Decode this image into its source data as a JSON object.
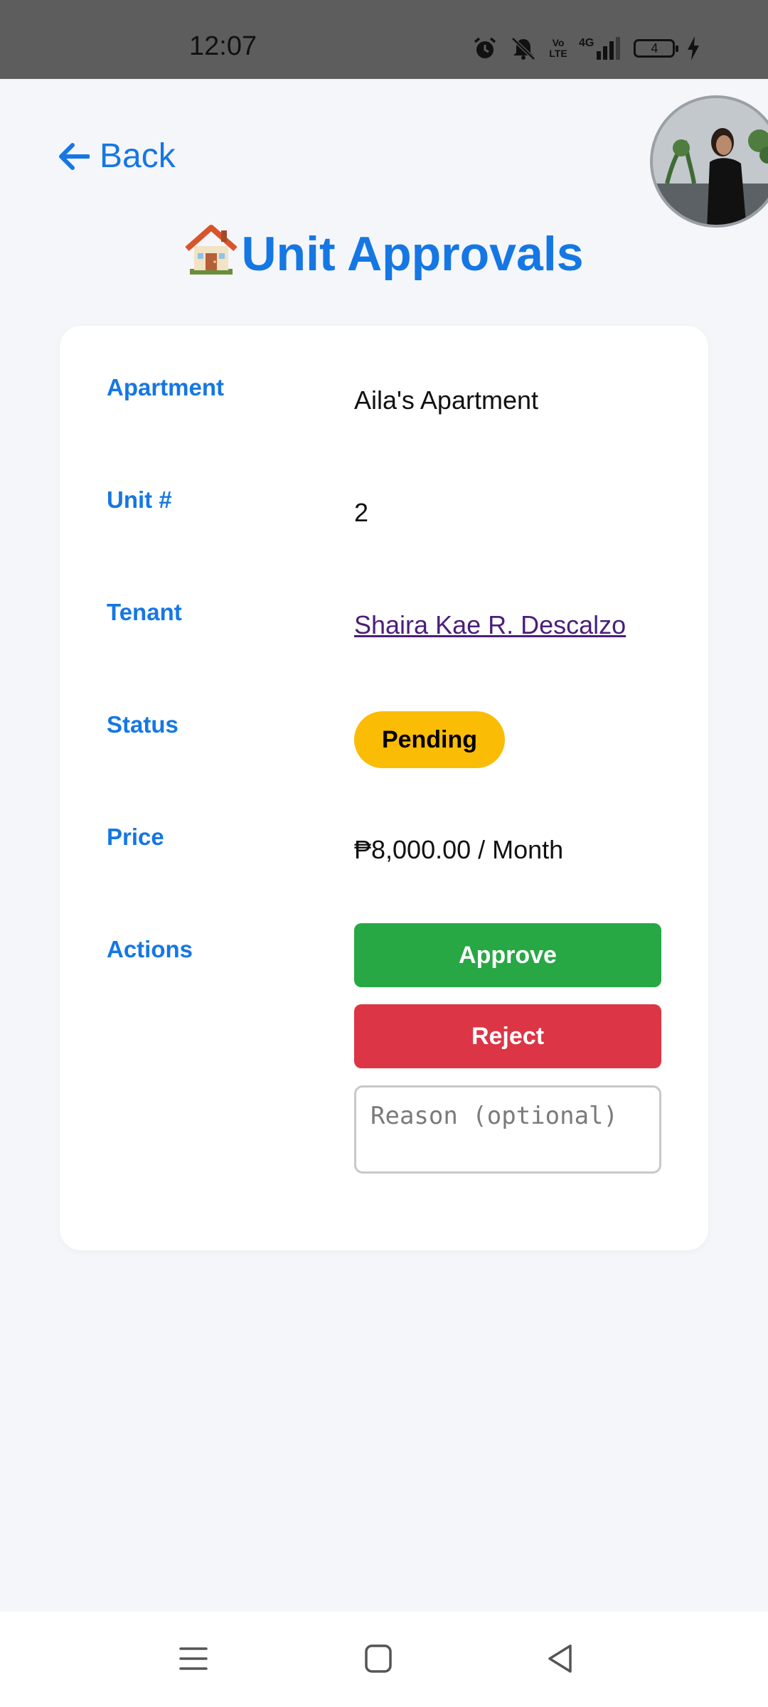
{
  "status_bar": {
    "time": "12:07",
    "network_label": "4G",
    "volte_label": "Vo LTE",
    "battery_level": "4"
  },
  "header": {
    "back_label": "Back",
    "title": "Unit Approvals",
    "title_icon": "house-icon"
  },
  "details": {
    "apartment_label": "Apartment",
    "apartment_value": "Aila's Apartment",
    "unit_label": "Unit #",
    "unit_value": "2",
    "tenant_label": "Tenant",
    "tenant_value": "Shaira Kae R. Descalzo",
    "status_label": "Status",
    "status_value": "Pending",
    "price_label": "Price",
    "price_value": "₱8,000.00 / Month",
    "actions_label": "Actions"
  },
  "actions": {
    "approve_label": "Approve",
    "reject_label": "Reject",
    "reason_placeholder": "Reason (optional)",
    "reason_value": ""
  },
  "colors": {
    "accent": "#1577e3",
    "approve": "#28a745",
    "reject": "#dc3545",
    "pending": "#fbbc05",
    "tenant_link": "#4a1f7a"
  }
}
